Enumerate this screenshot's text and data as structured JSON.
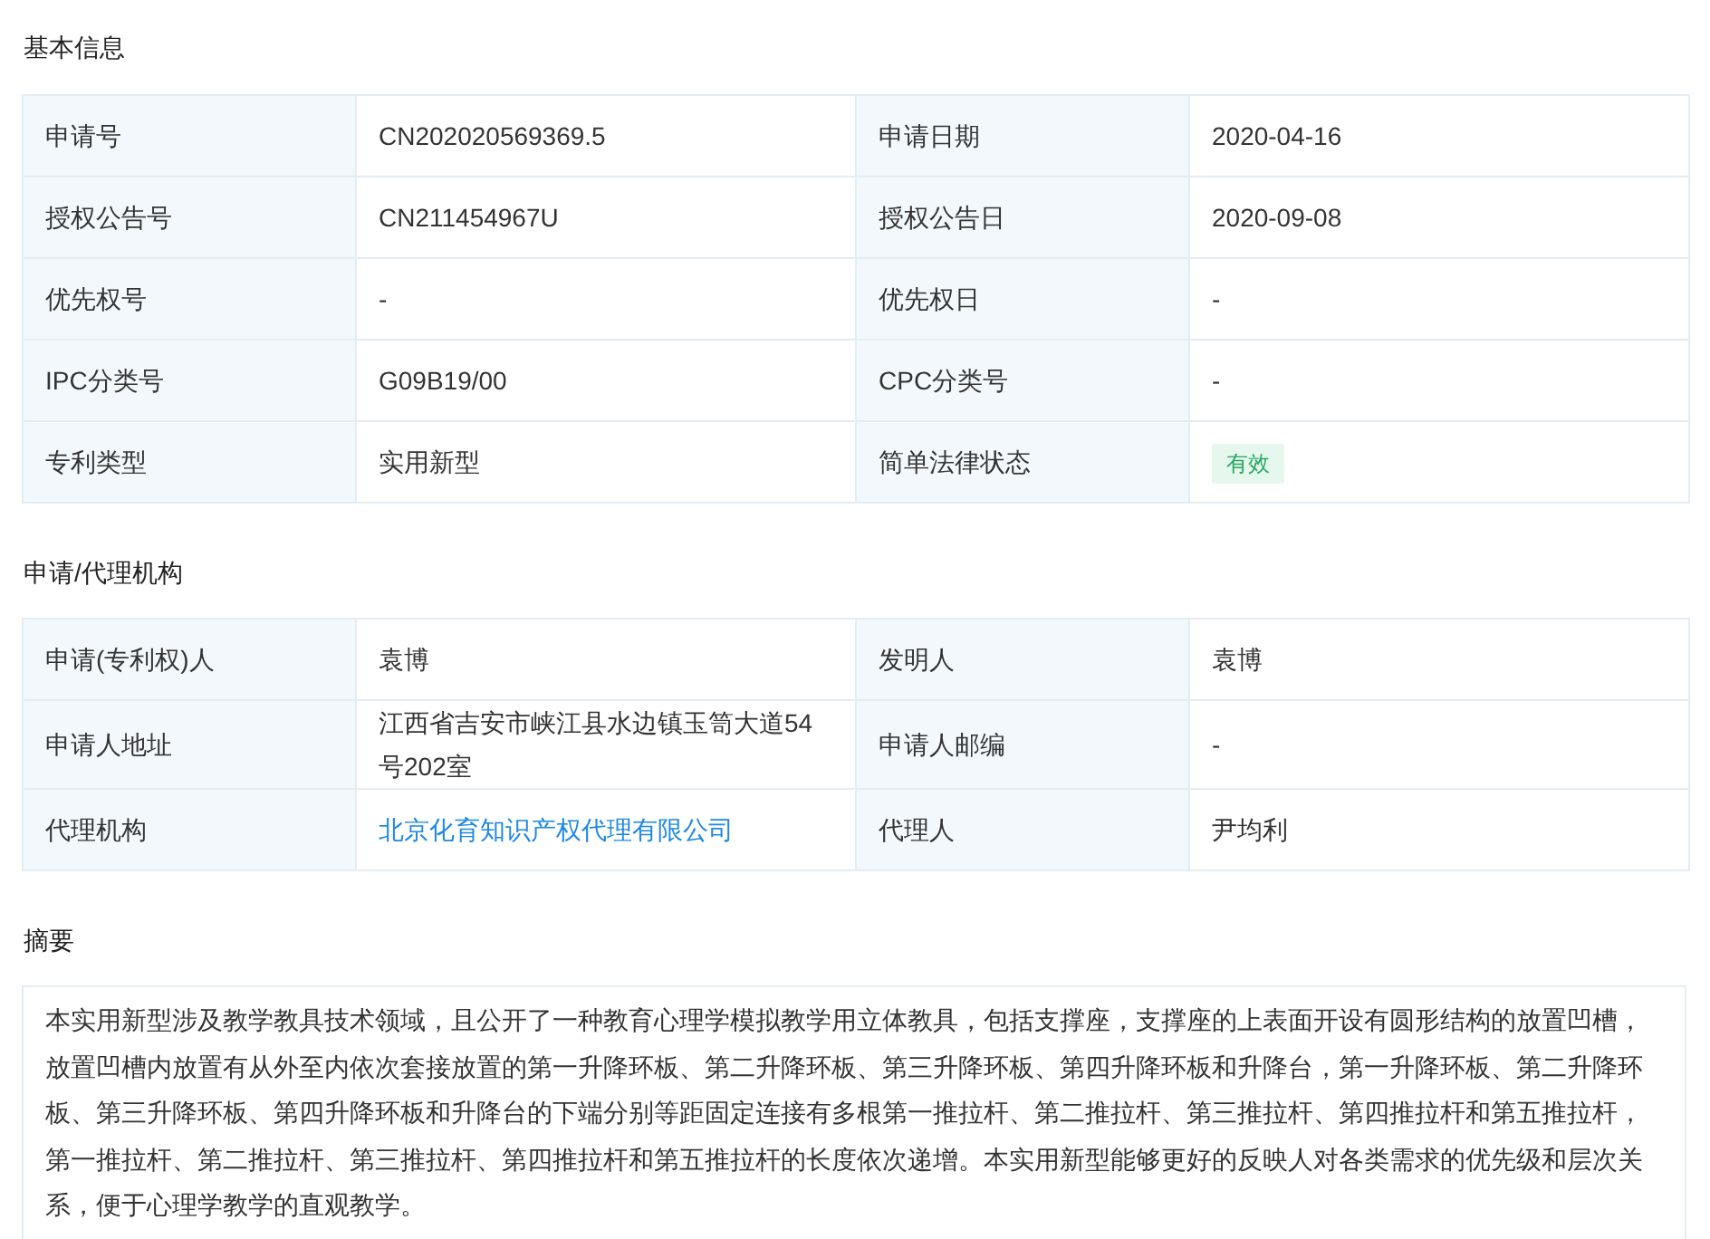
{
  "sections": [
    {
      "title": "基本信息",
      "rows": [
        {
          "cells": [
            {
              "label": "申请号",
              "value": "CN202020569369.5",
              "kind": "text"
            },
            {
              "label": "申请日期",
              "value": "2020-04-16",
              "kind": "text"
            }
          ]
        },
        {
          "cells": [
            {
              "label": "授权公告号",
              "value": "CN211454967U",
              "kind": "text"
            },
            {
              "label": "授权公告日",
              "value": "2020-09-08",
              "kind": "text"
            }
          ]
        },
        {
          "cells": [
            {
              "label": "优先权号",
              "value": "-",
              "kind": "text"
            },
            {
              "label": "优先权日",
              "value": "-",
              "kind": "text"
            }
          ]
        },
        {
          "cells": [
            {
              "label": "IPC分类号",
              "value": "G09B19/00",
              "kind": "text"
            },
            {
              "label": "CPC分类号",
              "value": "-",
              "kind": "text"
            }
          ]
        },
        {
          "cells": [
            {
              "label": "专利类型",
              "value": "实用新型",
              "kind": "text"
            },
            {
              "label": "简单法律状态",
              "value": "有效",
              "kind": "badge"
            }
          ]
        }
      ]
    },
    {
      "title": "申请/代理机构",
      "rows": [
        {
          "cells": [
            {
              "label": "申请(专利权)人",
              "value": "袁博",
              "kind": "text"
            },
            {
              "label": "发明人",
              "value": "袁博",
              "kind": "text"
            }
          ]
        },
        {
          "cells": [
            {
              "label": "申请人地址",
              "value": "江西省吉安市峡江县水边镇玉笥大道54号202室",
              "kind": "text"
            },
            {
              "label": "申请人邮编",
              "value": "-",
              "kind": "text"
            }
          ]
        },
        {
          "cells": [
            {
              "label": "代理机构",
              "value": "北京化育知识产权代理有限公司",
              "kind": "link"
            },
            {
              "label": "代理人",
              "value": "尹均利",
              "kind": "text"
            }
          ]
        }
      ]
    }
  ],
  "abstract": {
    "title": "摘要",
    "text": "本实用新型涉及教学教具技术领域，且公开了一种教育心理学模拟教学用立体教具，包括支撑座，支撑座的上表面开设有圆形结构的放置凹槽，放置凹槽内放置有从外至内依次套接放置的第一升降环板、第二升降环板、第三升降环板、第四升降环板和升降台，第一升降环板、第二升降环板、第三升降环板、第四升降环板和升降台的下端分别等距固定连接有多根第一推拉杆、第二推拉杆、第三推拉杆、第四推拉杆和第五推拉杆，第一推拉杆、第二推拉杆、第三推拉杆、第四推拉杆和第五推拉杆的长度依次递增。本实用新型能够更好的反映人对各类需求的优先级和层次关系，便于心理学教学的直观教学。"
  }
}
